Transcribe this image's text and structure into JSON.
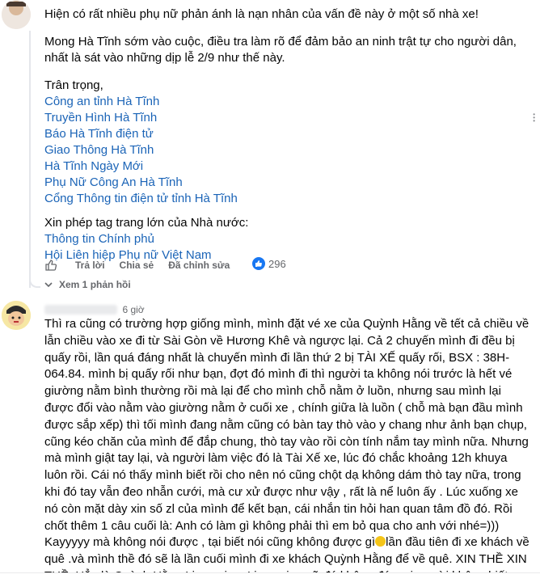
{
  "comment1": {
    "lines": [
      "Hiện có rất nhiều phụ nữ phản ánh là nạn nhân của vấn đề này ở một số nhà xe!",
      "Mong Hà Tĩnh sớm vào cuộc, điều tra làm rõ để đảm bảo an ninh trật tự cho người dân, nhất là sát vào những dịp lễ 2/9 như thế này.",
      "Trân trọng,"
    ],
    "links_group1": [
      "Công an tỉnh Hà Tĩnh",
      "Truyền Hình Hà Tĩnh",
      "Báo Hà Tĩnh điện tử",
      "Giao Thông Hà Tĩnh",
      "Hà Tĩnh Ngày Mới",
      "Phụ Nữ Công An Hà Tĩnh",
      "Cổng Thông tin điện tử tỉnh Hà Tĩnh"
    ],
    "tag_line": "Xin phép tag trang lớn của Nhà nước:",
    "links_group2": [
      "Thông tin Chính phủ",
      "Hội Liên hiệp Phụ nữ Việt Nam"
    ],
    "actions": {
      "reply": "Trả lời",
      "share": "Chia sẻ",
      "edited": "Đã chỉnh sửa"
    },
    "reaction_count": "296",
    "view_replies": "Xem 1 phản hồi"
  },
  "comment2": {
    "time": "6 giờ",
    "body_before_emoji": "Thì ra cũng có trường hợp giống mình, mình đặt vé xe của Quỳnh Hằng về tết cả chiều về lẫn chiều vào xe đi từ Sài Gòn về Hương Khê và ngược lại. Cả 2 chuyến mình đi đều bị quấy rồi, lần quá đáng nhất là chuyến mình đi lần thứ 2 bị TÀI XẾ quấy rối, BSX : 38H-064.84. mình bị quấy rối như bạn, đợt đó mình đi thì người ta không nói trước là hết vé giường nằm bình thường rồi mà lại để cho mình chỗ nằm ở luồn, nhưng sau mình lại được đổi vào nằm vào giường nằm ở cuối xe , chính giữa là luồn ( chỗ mà bạn đầu mình được sắp xếp) thì tối mình đang nằm cũng có bàn tay thò vào y chang như ảnh bạn chụp, cũng kéo chăn của mình để đắp chung, thò tay vào rồi còn tính nắm tay mình nữa. Nhưng mà mình giật tay lại, và người làm việc đó là Tài Xế xe, lúc đó chắc khoảng 12h khuya luôn rồi. Cái nó thấy mình biết rồi cho nên nó cũng chột dạ không dám thò tay nữa, trong khi đó tay vẫn đeo nhẫn cưới, mà cư xử được như vậy , rất là nể luôn ấy . Lúc xuống xe nó còn mặt dày xin số zl của mình để kết bạn, cái nhắn tin hỏi han quan tâm đồ đó. Rồi chốt thêm 1 câu cuối là: Anh có làm gì không phải thì em bỏ qua cho anh với nhé=))) Kayyyyy mà không nói được , tại biết nói cũng không được gì",
    "body_after_emoji": "lần đầu tiên đi xe khách về quê .và mình thề đó sẽ là lần cuối mình đi xe khách Quỳnh Hằng để về quê. XIN THỀ XIN THỀ. Hẳn là Quỳnh Hằng Limousine. Limousine cỡ đó không đó mọi người không biết xe"
  },
  "icons": [
    "like-icon",
    "thumbs-up-reaction-icon",
    "chevron-icon",
    "emoji-smile-icon"
  ],
  "colors": {
    "link": "#1b64b7",
    "meta": "#65676b",
    "accent": "#1877f2"
  }
}
